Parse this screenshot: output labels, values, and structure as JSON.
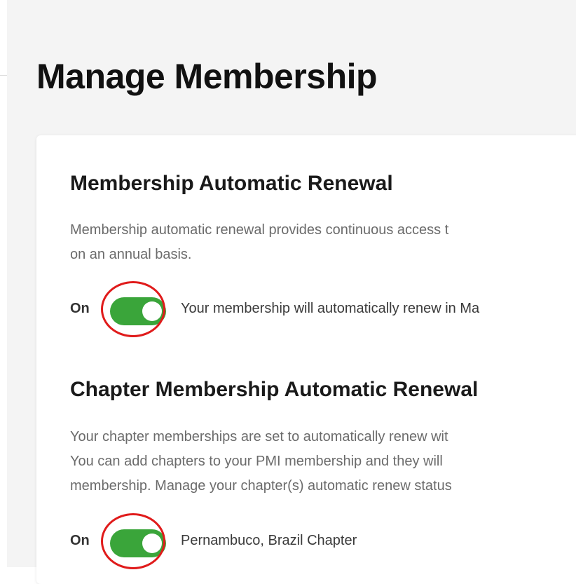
{
  "page": {
    "title": "Manage Membership"
  },
  "membership_renewal": {
    "title": "Membership Automatic Renewal",
    "description_lines": [
      "Membership automatic renewal provides continuous access t",
      "on an annual basis."
    ],
    "toggle_label": "On",
    "toggle_state": "on",
    "status_text": "Your membership will automatically renew in Ma"
  },
  "chapter_renewal": {
    "title": "Chapter Membership Automatic Renewal",
    "description_lines": [
      "Your chapter memberships are set to automatically renew wit",
      "You can add chapters to your PMI membership and they will",
      "membership. Manage your chapter(s) automatic renew status"
    ],
    "toggle_label": "On",
    "toggle_state": "on",
    "chapter_name": "Pernambuco, Brazil Chapter"
  },
  "colors": {
    "toggle_on": "#3aa53a",
    "highlight": "#e01b1b",
    "page_background": "#f4f4f4"
  }
}
